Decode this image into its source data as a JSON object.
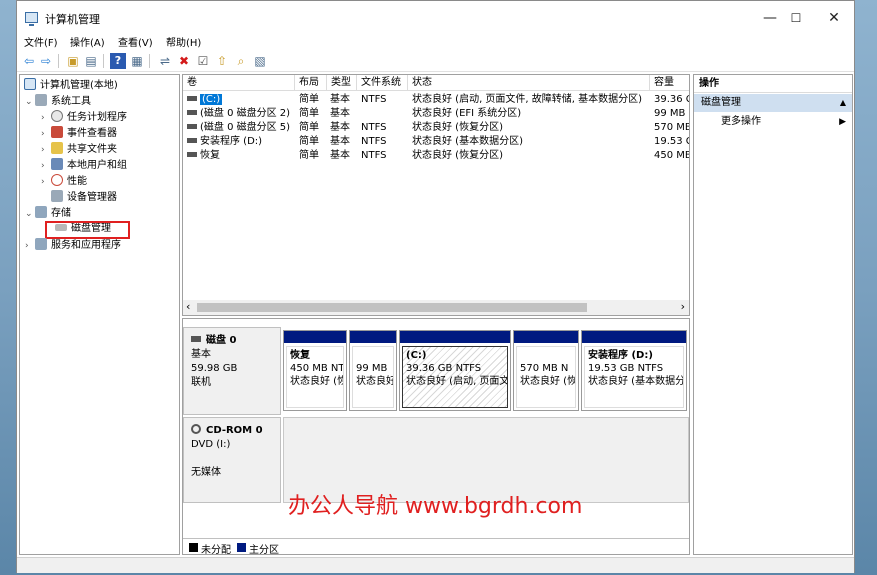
{
  "window": {
    "title": "计算机管理",
    "minimize": "—",
    "maximize": "☐",
    "close": "✕"
  },
  "menu": [
    "文件(F)",
    "操作(A)",
    "查看(V)",
    "帮助(H)"
  ],
  "toolbar": {
    "back": "⇦",
    "forward": "⇨",
    "up": "▣",
    "show_hide": "▤",
    "help": "?",
    "properties": "▦",
    "connect": "⇌",
    "delete": "✖",
    "check": "☑",
    "export": "⇧",
    "search": "⌕",
    "view": "▧"
  },
  "tree": {
    "root": "计算机管理(本地)",
    "system_tools": "系统工具",
    "task_scheduler": "任务计划程序",
    "event_viewer": "事件查看器",
    "shared_folders": "共享文件夹",
    "local_users": "本地用户和组",
    "performance": "性能",
    "device_manager": "设备管理器",
    "storage": "存储",
    "disk_management": "磁盘管理",
    "services_apps": "服务和应用程序"
  },
  "volume_table": {
    "headers": [
      "卷",
      "布局",
      "类型",
      "文件系统",
      "状态",
      "容量"
    ],
    "rows": [
      [
        "(C:)",
        "简单",
        "基本",
        "NTFS",
        "状态良好 (启动, 页面文件, 故障转储, 基本数据分区)",
        "39.36 C"
      ],
      [
        "(磁盘 0 磁盘分区 2)",
        "简单",
        "基本",
        "",
        "状态良好 (EFI 系统分区)",
        "99 MB"
      ],
      [
        "(磁盘 0 磁盘分区 5)",
        "简单",
        "基本",
        "NTFS",
        "状态良好 (恢复分区)",
        "570 MB"
      ],
      [
        "安装程序 (D:)",
        "简单",
        "基本",
        "NTFS",
        "状态良好 (基本数据分区)",
        "19.53 G"
      ],
      [
        "恢复",
        "简单",
        "基本",
        "NTFS",
        "状态良好 (恢复分区)",
        "450 MB"
      ]
    ],
    "scroll_left": "‹",
    "scroll_right": "›"
  },
  "disks": [
    {
      "name": "磁盘 0",
      "type": "基本",
      "size": "59.98 GB",
      "status": "联机"
    },
    {
      "name": "CD-ROM 0",
      "type": "DVD (I:)",
      "size": "",
      "status": "无媒体"
    }
  ],
  "partitions": [
    {
      "name": "恢复",
      "size": "450 MB NT",
      "status": "状态良好 (恢"
    },
    {
      "name": "",
      "size": "99 MB",
      "status": "状态良好"
    },
    {
      "name": "(C:)",
      "size": "39.36 GB NTFS",
      "status": "状态良好 (启动, 页面文"
    },
    {
      "name": "",
      "size": "570 MB N",
      "status": "状态良好 (恢"
    },
    {
      "name": "安装程序  (D:)",
      "size": "19.53 GB NTFS",
      "status": "状态良好 (基本数据分"
    }
  ],
  "legend": {
    "unallocated": "未分配",
    "primary": "主分区"
  },
  "colors": {
    "unallocated": "#000000",
    "primary": "#001a80",
    "selection": "#e02020"
  },
  "actions": {
    "header": "操作",
    "section": "磁盘管理",
    "more": "更多操作"
  },
  "watermark": "办公人导航 www.bgrdh.com"
}
